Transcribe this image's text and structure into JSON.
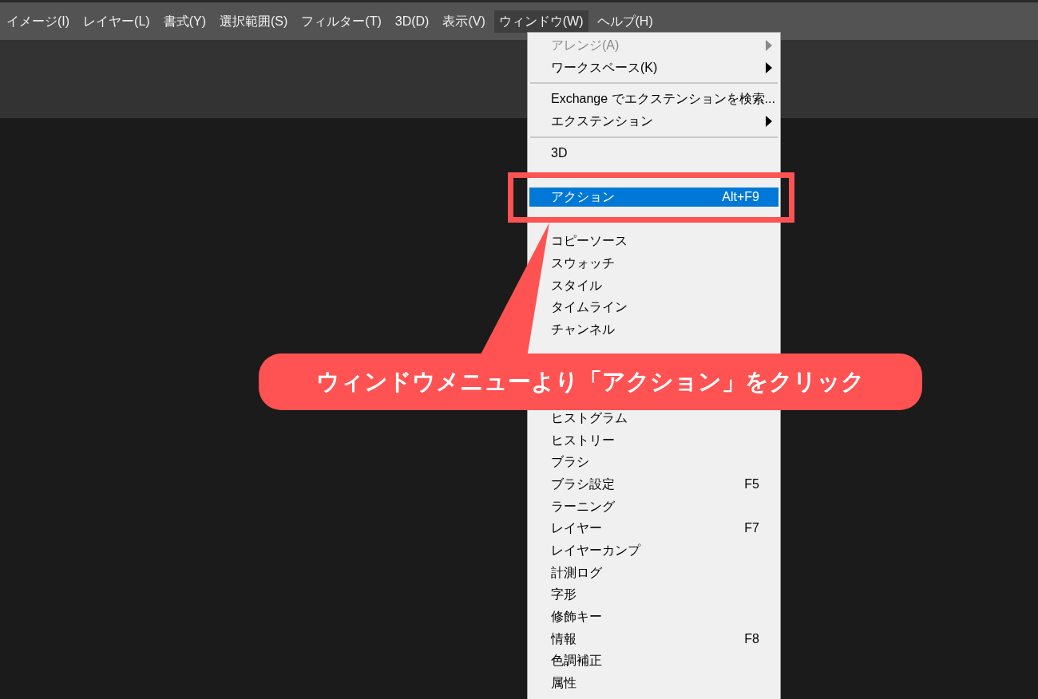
{
  "menu_bar": [
    {
      "label": "イメージ(I)",
      "selected": false
    },
    {
      "label": "レイヤー(L)",
      "selected": false
    },
    {
      "label": "書式(Y)",
      "selected": false
    },
    {
      "label": "選択範囲(S)",
      "selected": false
    },
    {
      "label": "フィルター(T)",
      "selected": false
    },
    {
      "label": "3D(D)",
      "selected": false
    },
    {
      "label": "表示(V)",
      "selected": false
    },
    {
      "label": "ウィンドウ(W)",
      "selected": true
    },
    {
      "label": "ヘルプ(H)",
      "selected": false
    }
  ],
  "window_menu": {
    "items": [
      {
        "kind": "item",
        "label": "アレンジ(A)",
        "submenu": true,
        "disabled": true,
        "selected": false
      },
      {
        "kind": "item",
        "label": "ワークスペース(K)",
        "submenu": true,
        "disabled": false,
        "selected": false
      },
      {
        "kind": "separator"
      },
      {
        "kind": "item",
        "label": "Exchange でエクステンションを検索...",
        "submenu": false,
        "disabled": false,
        "selected": false
      },
      {
        "kind": "item",
        "label": "エクステンション",
        "submenu": true,
        "disabled": false,
        "selected": false
      },
      {
        "kind": "separator"
      },
      {
        "kind": "item",
        "label": "3D",
        "submenu": false,
        "disabled": false,
        "selected": false
      },
      {
        "kind": "covered"
      },
      {
        "kind": "item",
        "label": "アクション",
        "shortcut": "Alt+F9",
        "submenu": false,
        "disabled": false,
        "selected": true
      },
      {
        "kind": "covered"
      },
      {
        "kind": "item",
        "label": "コピーソース",
        "submenu": false,
        "disabled": false,
        "selected": false
      },
      {
        "kind": "item",
        "label": "スウォッチ",
        "submenu": false,
        "disabled": false,
        "selected": false
      },
      {
        "kind": "item",
        "label": "スタイル",
        "submenu": false,
        "disabled": false,
        "selected": false
      },
      {
        "kind": "item",
        "label": "タイムライン",
        "submenu": false,
        "disabled": false,
        "selected": false
      },
      {
        "kind": "item",
        "label": "チャンネル",
        "submenu": false,
        "disabled": false,
        "selected": false
      },
      {
        "kind": "covered"
      },
      {
        "kind": "covered"
      },
      {
        "kind": "covered"
      },
      {
        "kind": "item",
        "label": "ヒストグラム",
        "submenu": false,
        "disabled": false,
        "selected": false
      },
      {
        "kind": "item",
        "label": "ヒストリー",
        "submenu": false,
        "disabled": false,
        "selected": false
      },
      {
        "kind": "item",
        "label": "ブラシ",
        "submenu": false,
        "disabled": false,
        "selected": false
      },
      {
        "kind": "item",
        "label": "ブラシ設定",
        "shortcut": "F5",
        "submenu": false,
        "disabled": false,
        "selected": false
      },
      {
        "kind": "item",
        "label": "ラーニング",
        "submenu": false,
        "disabled": false,
        "selected": false
      },
      {
        "kind": "item",
        "label": "レイヤー",
        "shortcut": "F7",
        "submenu": false,
        "disabled": false,
        "selected": false
      },
      {
        "kind": "item",
        "label": "レイヤーカンプ",
        "submenu": false,
        "disabled": false,
        "selected": false
      },
      {
        "kind": "item",
        "label": "計測ログ",
        "submenu": false,
        "disabled": false,
        "selected": false
      },
      {
        "kind": "item",
        "label": "字形",
        "submenu": false,
        "disabled": false,
        "selected": false
      },
      {
        "kind": "item",
        "label": "修飾キー",
        "submenu": false,
        "disabled": false,
        "selected": false
      },
      {
        "kind": "item",
        "label": "情報",
        "shortcut": "F8",
        "submenu": false,
        "disabled": false,
        "selected": false
      },
      {
        "kind": "item",
        "label": "色調補正",
        "submenu": false,
        "disabled": false,
        "selected": false
      },
      {
        "kind": "item",
        "label": "属性",
        "submenu": false,
        "disabled": false,
        "selected": false
      }
    ]
  },
  "annotation": {
    "callout": "ウィンドウメニューより「アクション」をクリック"
  }
}
